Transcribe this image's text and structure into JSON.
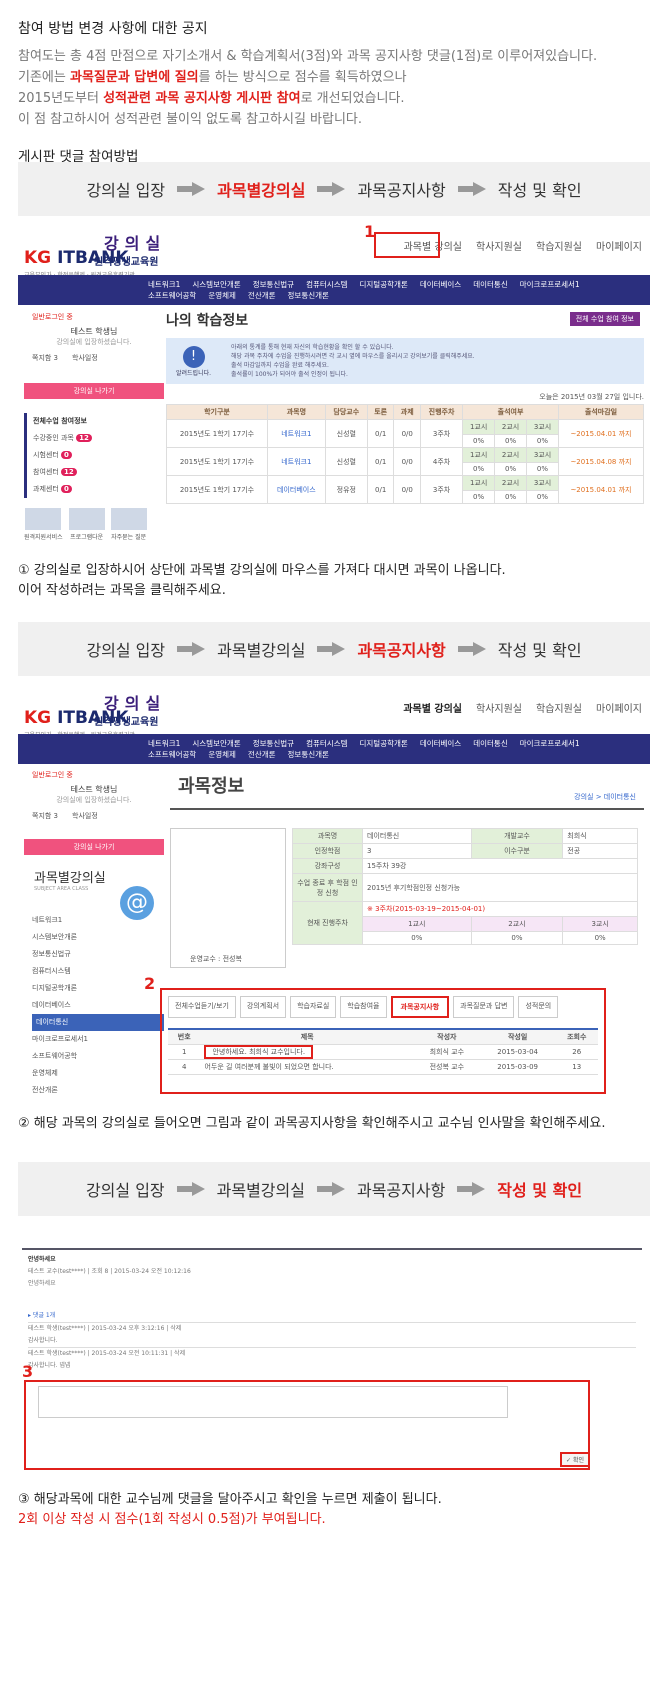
{
  "notice_title": "참여 방법 변경 사항에 대한 공지",
  "intro": {
    "line1": "참여도는 총 4점 만점으로 자기소개서 & 학습계획서(3점)와 과목 공지사항 댓글(1점)로 이루어져있습니다.",
    "line2_a": "기존에는 ",
    "line2_red": "과목질문과 답변에 질의",
    "line2_b": "를 하는 방식으로 점수를 획득하였으나",
    "line3_a": "2015년도부터 ",
    "line3_red": "성적관련 과목 공지사항 게시판 참여",
    "line3_b": "로 개선되었습니다.",
    "line4": "이 점 참고하시어 성적관련 불이익 없도록 참고하시길 바랍니다."
  },
  "sub_title": "게시판 댓글 참여방법",
  "steps": [
    "강의실 입장",
    "과목별강의실",
    "과목공지사항",
    "작성 및 확인"
  ],
  "logo": {
    "kg": "KG",
    "itbank": "ITBANK",
    "lecture": "강의실",
    "org": "원격평생교육원",
    "tag": "교육부인가 · 학점은행제 · 원격교육훈련기관"
  },
  "top_menu": [
    "과목별 강의실",
    "학사지원실",
    "학습지원실",
    "마이페이지"
  ],
  "gnb_row1": [
    "네트워크1",
    "시스템보안개론",
    "정보통신법규",
    "컴퓨터시스템",
    "디지털공학개론",
    "데이터베이스",
    "데이터통신",
    "마이크로프로세서1"
  ],
  "gnb_row2": [
    "소프트웨어공학",
    "운영체제",
    "전산개론",
    "정보통신개론"
  ],
  "shot1": {
    "login": "일반로그인 중",
    "user": "테스트 학생님",
    "user_sub": "강의실에 입장하셨습니다.",
    "note": "쪽지함 3",
    "schedule": "학사일정",
    "exit": "강의실 나가기",
    "menu_head": "전체수업 참여정보",
    "menu": [
      {
        "label": "수강중인 과목",
        "count": "12"
      },
      {
        "label": "시험센터",
        "count": "0"
      },
      {
        "label": "참여센터",
        "count": "12"
      },
      {
        "label": "과제센터",
        "count": "0"
      }
    ],
    "icons": [
      "원격지원서비스",
      "프로그램다운",
      "자주묻는 질문"
    ],
    "page_title": "나의 학습정보",
    "all_btn": "전체 수업 참여 정보",
    "alert_label": "알려드립니다.",
    "alert_lines": [
      "아래의 통계를 통해 현재 자신의 학습현황을 확인 할 수 있습니다.",
      "해당 과목 주차에 수업을 진행하시려면 각 교시 옆에 마우스를 올리시고 강의보기를 클릭해주세요.",
      "출석 마감일까지 수업을 완료 해주세요.",
      "출석률이 100%가 되어야 출석 인정이 됩니다."
    ],
    "today": "오늘은 2015년 03월 27일 입니다.",
    "headers": [
      "학기구분",
      "과목명",
      "담당교수",
      "토론",
      "과제",
      "진행주차",
      "출석여부",
      "출석마감일"
    ],
    "periods": [
      "1교시",
      "2교시",
      "3교시"
    ],
    "rows": [
      {
        "term": "2015년도 1학기 17기수",
        "course": "네트워크1",
        "prof": "신성렬",
        "debate": "0/1",
        "task": "0/0",
        "week": "3주차",
        "att": [
          "0%",
          "0%",
          "0%"
        ],
        "due": "~2015.04.01 까지"
      },
      {
        "term": "2015년도 1학기 17기수",
        "course": "네트워크1",
        "prof": "신성렬",
        "debate": "0/1",
        "task": "0/0",
        "week": "4주차",
        "att": [
          "0%",
          "0%",
          "0%"
        ],
        "due": "~2015.04.08 까지"
      },
      {
        "term": "2015년도 1학기 17기수",
        "course": "데이터베이스",
        "prof": "정유정",
        "debate": "0/1",
        "task": "0/0",
        "week": "3주차",
        "att": [
          "0%",
          "0%",
          "0%"
        ],
        "due": "~2015.04.01 까지"
      }
    ]
  },
  "desc1": [
    "① 강의실로 입장하시어 상단에 과목별 강의실에 마우스를 가져다 대시면 과목이 나옵니다.",
    "이어 작성하려는 과목을 클릭해주세요."
  ],
  "shot2": {
    "class_title": "과목별강의실",
    "class_sub": "SUBJECT AREA CLASS",
    "courses": [
      "네트워크1",
      "시스템보안개론",
      "정보통신법규",
      "컴퓨터시스템",
      "디지털공학개론",
      "데이터베이스",
      "데이터통신",
      "마이크로프로세서1",
      "소프트웨어공학",
      "운영체제",
      "전산개론"
    ],
    "page_title": "과목정보",
    "breadcrumb": "강의실 > 데이터통신",
    "info": {
      "course_k": "과목명",
      "course_v": "데이터통신",
      "prof_k": "개발교수",
      "prof_v": "최희식",
      "credit_k": "인정학점",
      "credit_v": "3",
      "type_k": "이수구분",
      "type_v": "전공",
      "comp_k": "강좌구성",
      "comp_v": "15주차 39강",
      "after_k": "수업 종료 후 학점 인정 신청",
      "after_v": "2015년 후기학점인정 신청가능",
      "now_k": "현재 진행주차",
      "now_v": "※ 3주차(2015-03-19~2015-04-01)"
    },
    "teacher": "운영교수 : 전성복",
    "tabs": [
      "전체수업듣기/보기",
      "강의계획서",
      "학습자료실",
      "학습참여율",
      "과목공지사항",
      "과목질문과 답변",
      "성적문의"
    ],
    "board_headers": [
      "번호",
      "제목",
      "작성자",
      "작성일",
      "조회수"
    ],
    "board": [
      {
        "no": "1",
        "title": "안녕하세요. 최희식 교수입니다.",
        "writer": "최희식 교수",
        "date": "2015-03-04",
        "views": "26"
      },
      {
        "no": "4",
        "title": "어두운 길 여러분께 불빛이 되었으면 합니다.",
        "writer": "전성복 교수",
        "date": "2015-03-09",
        "views": "13"
      }
    ]
  },
  "desc2": "② 해당 과목의 강의실로 들어오면 그림과 같이 과목공지사항을 확인해주시고 교수님 인사말을 확인해주세요.",
  "shot3": {
    "board_title": "안녕하세요",
    "author1": "테스트 교수(test****) | 조회 8 | 2015-03-24 오전 10:12:16",
    "body": "안녕하세요",
    "reply_head": "▸ 댓글 1개",
    "reply1": "테스트 학생(test****) | 2015-03-24 오후 3:12:16 | 삭제",
    "reply1_body": "감사합니다.",
    "reply2": "테스트 학생(test****) | 2015-03-24 오전 10:11:31 | 삭제",
    "reply2_body": "감사합니다. 넵넵",
    "submit": "확인"
  },
  "desc3_line1": "③ 해당과목에 대한 교수님께 댓글을 달아주시고 확인을 누르면 제출이 됩니다.",
  "desc3_line2": "2회 이상 작성 시 점수(1회 작성시 0.5점)가 부여됩니다.",
  "markers": [
    "1",
    "2",
    "3"
  ]
}
